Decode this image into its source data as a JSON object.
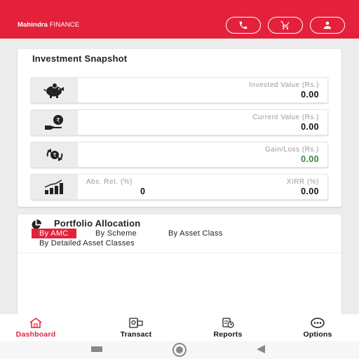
{
  "header": {
    "logo_bold": "Mahindra",
    "logo_thin": "FINANCE",
    "buttons": [
      "phone-icon",
      "cart-icon",
      "user-icon"
    ],
    "brand_color": "#e3213a"
  },
  "snapshot": {
    "title": "Investment Snapshot",
    "invested": {
      "label": "Invested Value (Rs.)",
      "value": "0.00",
      "icon": "piggy-bank-icon"
    },
    "current": {
      "label": "Current Value (Rs.)",
      "value": "0.00",
      "icon": "hand-rupee-icon"
    },
    "gainloss": {
      "label": "Gain/Loss (Rs.)",
      "value": "0.00",
      "icon": "money-exchange-icon",
      "color": "#2e8b3e"
    },
    "abs": {
      "label": "Abs. Ret. (%)",
      "value": "0",
      "icon": "bar-chart-icon"
    },
    "xirr": {
      "label": "XIRR (%)",
      "value": "0.00"
    }
  },
  "portfolio": {
    "title": "Portfolio Allocation",
    "tabs": [
      "By AMC",
      "By Scheme",
      "By Asset Class",
      "By Detailed Asset Classes"
    ],
    "active_tab": "By AMC"
  },
  "bottom_nav": {
    "items": [
      {
        "label": "Dashboard",
        "icon": "home-icon",
        "active": true
      },
      {
        "label": "Transact",
        "icon": "transact-icon"
      },
      {
        "label": "Reports",
        "icon": "reports-icon"
      },
      {
        "label": "Options",
        "icon": "more-icon"
      }
    ]
  }
}
